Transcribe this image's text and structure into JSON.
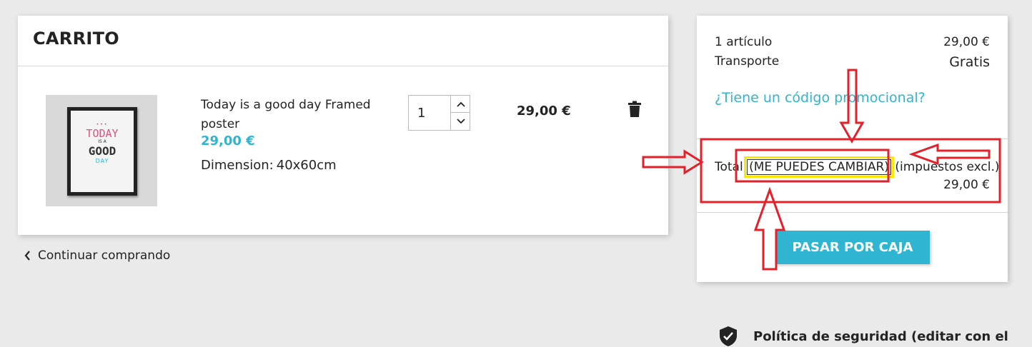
{
  "cart": {
    "title": "CARRITO",
    "item": {
      "name": "Today is a good day Framed poster",
      "unit_price": "29,00 €",
      "dimension_label": "Dimension:",
      "dimension_value": "40x60cm",
      "quantity": "1",
      "line_total": "29,00 €",
      "poster_text": {
        "today": "TODAY",
        "is_a": "IS A",
        "good": "GOOD",
        "day": "DAY"
      }
    },
    "continue_label": "Continuar comprando"
  },
  "summary": {
    "items_label": "1 artículo",
    "items_value": "29,00 €",
    "shipping_label": "Transporte",
    "shipping_value": "Gratis",
    "promo_link": "¿Tiene un código promocional?",
    "total_prefix": "Total",
    "total_highlight": "(ME PUEDES CAMBIAR)",
    "total_suffix": "(impuestos excl.)",
    "total_value": "29,00 €",
    "checkout_label": "PASAR POR CAJA"
  },
  "security": {
    "label": "Política de seguridad (editar con el"
  },
  "colors": {
    "accent": "#2fb5d2",
    "annotation_red": "#e4202a",
    "highlight_yellow": "#ffe600"
  },
  "icons": {
    "delete": "trash-icon",
    "back": "chevron-left-icon",
    "qty_up": "chevron-up-icon",
    "qty_down": "chevron-down-icon",
    "security": "shield-check-icon"
  }
}
